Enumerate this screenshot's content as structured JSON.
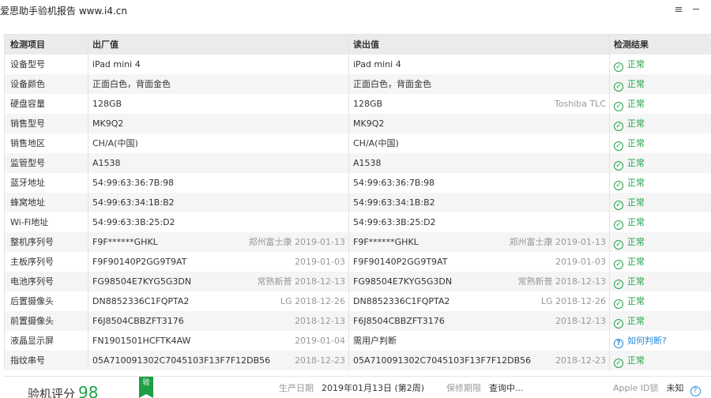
{
  "window": {
    "title": "爱思助手验机报告 www.i4.cn",
    "list_icon": "≡",
    "minimize_icon": "─"
  },
  "table": {
    "headers": [
      "检测项目",
      "出厂值",
      "读出值",
      "检测结果"
    ],
    "rows": [
      {
        "item": "设备型号",
        "factory": "iPad mini 4",
        "factory_note": "",
        "read": "iPad mini 4",
        "read_note": "",
        "result": "正常",
        "status": "ok"
      },
      {
        "item": "设备颜色",
        "factory": "正面白色，背面金色",
        "factory_note": "",
        "read": "正面白色，背面金色",
        "read_note": "",
        "result": "正常",
        "status": "ok"
      },
      {
        "item": "硬盘容量",
        "factory": "128GB",
        "factory_note": "",
        "read": "128GB",
        "read_note": "Toshiba TLC",
        "result": "正常",
        "status": "ok"
      },
      {
        "item": "销售型号",
        "factory": "MK9Q2",
        "factory_note": "",
        "read": "MK9Q2",
        "read_note": "",
        "result": "正常",
        "status": "ok"
      },
      {
        "item": "销售地区",
        "factory": "CH/A(中国)",
        "factory_note": "",
        "read": "CH/A(中国)",
        "read_note": "",
        "result": "正常",
        "status": "ok"
      },
      {
        "item": "监管型号",
        "factory": "A1538",
        "factory_note": "",
        "read": "A1538",
        "read_note": "",
        "result": "正常",
        "status": "ok"
      },
      {
        "item": "蓝牙地址",
        "factory": "54:99:63:36:7B:98",
        "factory_note": "",
        "read": "54:99:63:36:7B:98",
        "read_note": "",
        "result": "正常",
        "status": "ok"
      },
      {
        "item": "蜂窝地址",
        "factory": "54:99:63:34:1B:B2",
        "factory_note": "",
        "read": "54:99:63:34:1B:B2",
        "read_note": "",
        "result": "正常",
        "status": "ok"
      },
      {
        "item": "Wi-Fi地址",
        "factory": "54:99:63:3B:25:D2",
        "factory_note": "",
        "read": "54:99:63:3B:25:D2",
        "read_note": "",
        "result": "正常",
        "status": "ok"
      },
      {
        "item": "整机序列号",
        "factory": "F9F******GHKL",
        "factory_note": "郑州富士康 2019-01-13",
        "read": "F9F******GHKL",
        "read_note": "郑州富士康 2019-01-13",
        "result": "正常",
        "status": "ok"
      },
      {
        "item": "主板序列号",
        "factory": "F9F90140P2GG9T9AT",
        "factory_note": "2019-01-03",
        "read": "F9F90140P2GG9T9AT",
        "read_note": "2019-01-03",
        "result": "正常",
        "status": "ok"
      },
      {
        "item": "电池序列号",
        "factory": "FG98504E7KYG5G3DN",
        "factory_note": "常熟新普 2018-12-13",
        "read": "FG98504E7KYG5G3DN",
        "read_note": "常熟新普 2018-12-13",
        "result": "正常",
        "status": "ok"
      },
      {
        "item": "后置摄像头",
        "factory": "DN8852336C1FQPTA2",
        "factory_note": "LG 2018-12-26",
        "read": "DN8852336C1FQPTA2",
        "read_note": "LG 2018-12-26",
        "result": "正常",
        "status": "ok"
      },
      {
        "item": "前置摄像头",
        "factory": "F6J8504CBBZFT3176",
        "factory_note": "2018-12-13",
        "read": "F6J8504CBBZFT3176",
        "read_note": "2018-12-13",
        "result": "正常",
        "status": "ok"
      },
      {
        "item": "液晶显示屏",
        "factory": "FN1901501HCFTK4AW",
        "factory_note": "2019-01-04",
        "read": "需用户判断",
        "read_note": "",
        "result": "如何判断?",
        "status": "ask"
      },
      {
        "item": "指纹串号",
        "factory": "05A710091302C7045103F13F7F12DB56",
        "factory_note": "2018-12-23",
        "read": "05A710091302C7045103F13F7F12DB56",
        "read_note": "2018-12-23",
        "result": "正常",
        "status": "ok"
      }
    ],
    "ok_icon": "check-circle-icon",
    "ask_icon": "question-circle-icon"
  },
  "footer": {
    "score_label": "验机评分",
    "score_value": "98",
    "badge_text": "验",
    "production_label": "生产日期",
    "production_value": "2019年01月13日 (第2周)",
    "warranty_label": "保修期限",
    "warranty_value": "查询中...",
    "appleid_label": "Apple ID锁",
    "appleid_value": "未知",
    "help_icon": "?"
  },
  "colors": {
    "ok": "#21a34a",
    "ask": "#2a8bd6",
    "header_bg": "#ebebeb",
    "alt_row_bg": "#f5f5f5"
  }
}
